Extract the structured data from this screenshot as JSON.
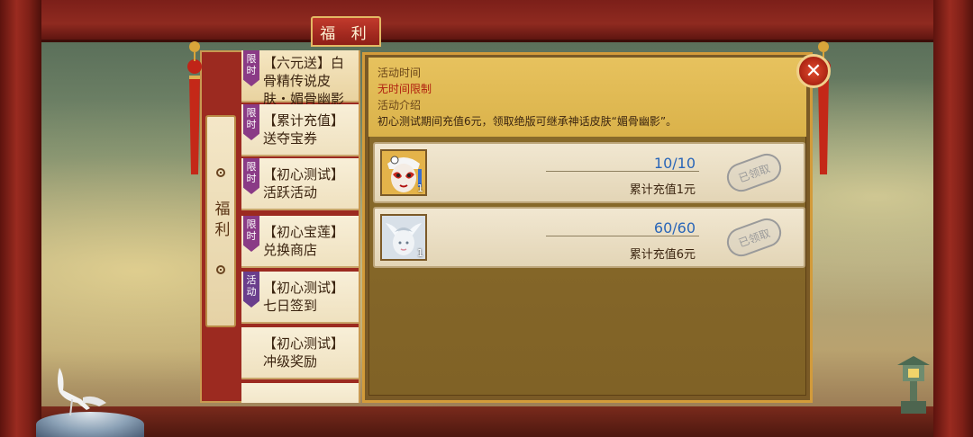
{
  "title": "福 利",
  "side_tab": "福利",
  "nav": [
    {
      "badge": "限时",
      "badge_type": "limited",
      "text": "【六元送】白骨精传说皮肤・媚骨幽影",
      "active": true
    },
    {
      "badge": "限时",
      "badge_type": "limited",
      "text": "【累计充值】送夺宝券",
      "active": false
    },
    {
      "badge": "限时",
      "badge_type": "limited",
      "text": "【初心测试】活跃活动",
      "active": false
    },
    {
      "badge": "限时",
      "badge_type": "limited",
      "text": "【初心宝莲】兑换商店",
      "active": false
    },
    {
      "badge": "活动",
      "badge_type": "event",
      "text": "【初心测试】七日签到",
      "active": false
    },
    {
      "badge": "",
      "badge_type": "",
      "text": "【初心测试】冲级奖励",
      "active": false
    }
  ],
  "info": {
    "time_label": "活动时间",
    "time_value": "无时间限制",
    "intro_label": "活动介绍",
    "intro_text": "初心测试期间充值6元，领取绝版可继承神话皮肤“媚骨幽影”。"
  },
  "rewards": [
    {
      "icon": "opera-mask-icon",
      "count": "1",
      "progress": "10/10",
      "requirement": "累计充值1元",
      "status": "已领取"
    },
    {
      "icon": "skin-portrait-icon",
      "count": "1",
      "progress": "60/60",
      "requirement": "累计充值6元",
      "status": "已领取"
    }
  ],
  "colors": {
    "accent": "#d39b3a",
    "progress": "#2a66b8",
    "red": "#b0200f"
  }
}
